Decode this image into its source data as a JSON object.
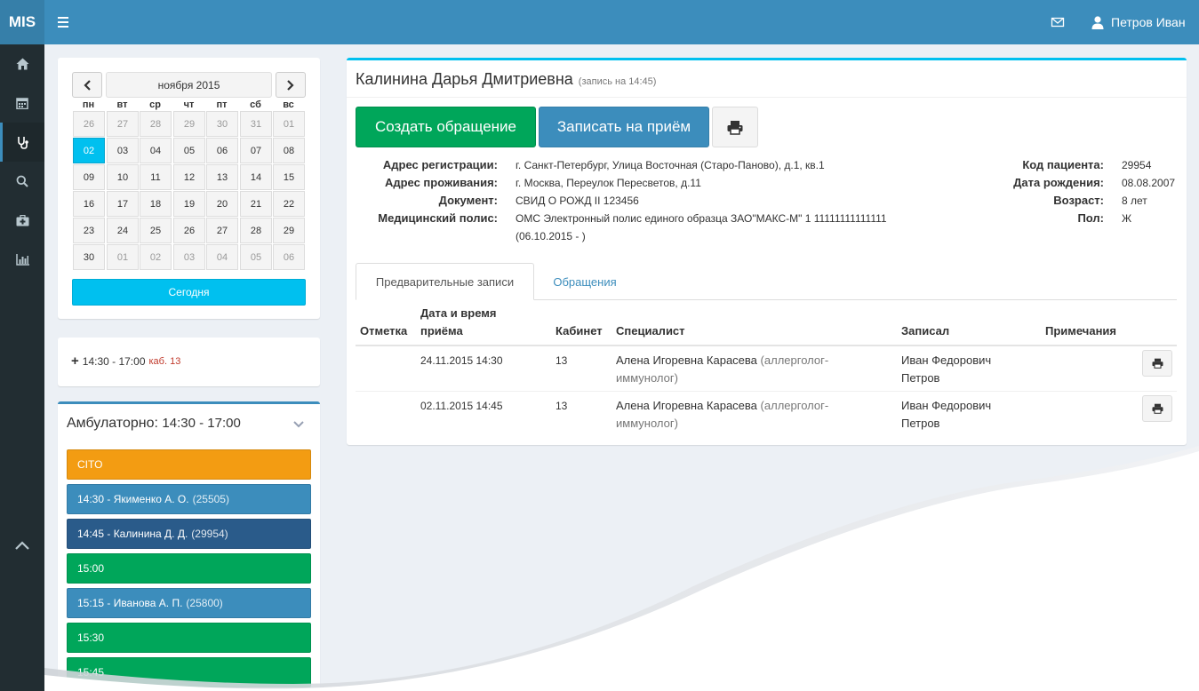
{
  "app": {
    "logo": "MIS",
    "user_name": "Петров Иван"
  },
  "colors": {
    "primary": "#3c8dbc",
    "info": "#00c0ef",
    "success": "#00a65a",
    "warning": "#f39c12",
    "dark_blue": "#2a5b8a",
    "sidebar": "#222d32"
  },
  "sidebar": {
    "items": [
      {
        "icon": "home-icon"
      },
      {
        "icon": "calendar-icon"
      },
      {
        "icon": "stethoscope-icon"
      },
      {
        "icon": "search-icon"
      },
      {
        "icon": "medkit-icon"
      },
      {
        "icon": "bar-chart-icon"
      }
    ],
    "active_index": 2
  },
  "calendar": {
    "month_label": "ноября 2015",
    "weekdays": [
      "пн",
      "вт",
      "ср",
      "чт",
      "пт",
      "сб",
      "вс"
    ],
    "weeks": [
      [
        "26",
        "27",
        "28",
        "29",
        "30",
        "31",
        "01"
      ],
      [
        "02",
        "03",
        "04",
        "05",
        "06",
        "07",
        "08"
      ],
      [
        "09",
        "10",
        "11",
        "12",
        "13",
        "14",
        "15"
      ],
      [
        "16",
        "17",
        "18",
        "19",
        "20",
        "21",
        "22"
      ],
      [
        "23",
        "24",
        "25",
        "26",
        "27",
        "28",
        "29"
      ],
      [
        "30",
        "01",
        "02",
        "03",
        "04",
        "05",
        "06"
      ]
    ],
    "selected": "02",
    "today_label": "Сегодня"
  },
  "shift": {
    "time": "14:30 - 17:00",
    "cabinet": "каб. 13"
  },
  "ambulatory": {
    "title": "Амбулаторно:",
    "time": "14:30 - 17:00",
    "slots": [
      {
        "label": "CITO",
        "color": "#f39c12"
      },
      {
        "label": "14:30 - Якименко А. О.",
        "sub": "(25505)",
        "color": "#3c8dbc"
      },
      {
        "label": "14:45 - Калинина Д. Д.",
        "sub": "(29954)",
        "color": "#2a5b8a"
      },
      {
        "label": "15:00",
        "sub": "",
        "color": "#00a65a"
      },
      {
        "label": "15:15 - Иванова А. П.",
        "sub": "(25800)",
        "color": "#3c8dbc"
      },
      {
        "label": "15:30",
        "sub": "",
        "color": "#00a65a"
      },
      {
        "label": "15:45",
        "sub": "",
        "color": "#00a65a"
      }
    ]
  },
  "patient": {
    "name": "Калинина Дарья Дмитриевна",
    "appointment_note": "(запись на 14:45)",
    "create_button": "Создать обращение",
    "book_button": "Записать на приём",
    "fields_left": [
      {
        "label": "Адрес регистрации:",
        "value": "г. Санкт-Петербург, Улица Восточная (Старо-Паново), д.1, кв.1"
      },
      {
        "label": "Адрес проживания:",
        "value": "г. Москва, Переулок Пересветов, д.11"
      },
      {
        "label": "Документ:",
        "value": "СВИД О РОЖД II 123456"
      },
      {
        "label": "Медицинский полис:",
        "value": "ОМС Электронный полис единого образца ЗАО\"МАКС-М\" 1 11111111111111",
        "value2": "(06.10.2015 - )"
      }
    ],
    "fields_right": [
      {
        "label": "Код пациента:",
        "value": "29954"
      },
      {
        "label": "Дата рождения:",
        "value": "08.08.2007"
      },
      {
        "label": "Возраст:",
        "value": "8 лет"
      },
      {
        "label": "Пол:",
        "value": "Ж"
      }
    ]
  },
  "tabs": [
    {
      "label": "Предварительные записи",
      "active": true
    },
    {
      "label": "Обращения",
      "active": false
    }
  ],
  "table": {
    "headers": {
      "mark": "Отметка",
      "datetime_1": "Дата и время",
      "datetime_2": "приёма",
      "cabinet": "Кабинет",
      "specialist": "Специалист",
      "recorded_by": "Записал",
      "notes": "Примечания"
    },
    "rows": [
      {
        "datetime": "24.11.2015 14:30",
        "cabinet": "13",
        "specialist": "Алена Игоревна Карасева",
        "specialty_1": "(аллерголог-",
        "specialty_2": "иммунолог)",
        "recorded_1": "Иван Федорович",
        "recorded_2": "Петров"
      },
      {
        "datetime": "02.11.2015 14:45",
        "cabinet": "13",
        "specialist": "Алена Игоревна Карасева",
        "specialty_1": "(аллерголог-",
        "specialty_2": "иммунолог)",
        "recorded_1": "Иван Федорович",
        "recorded_2": "Петров"
      }
    ]
  }
}
